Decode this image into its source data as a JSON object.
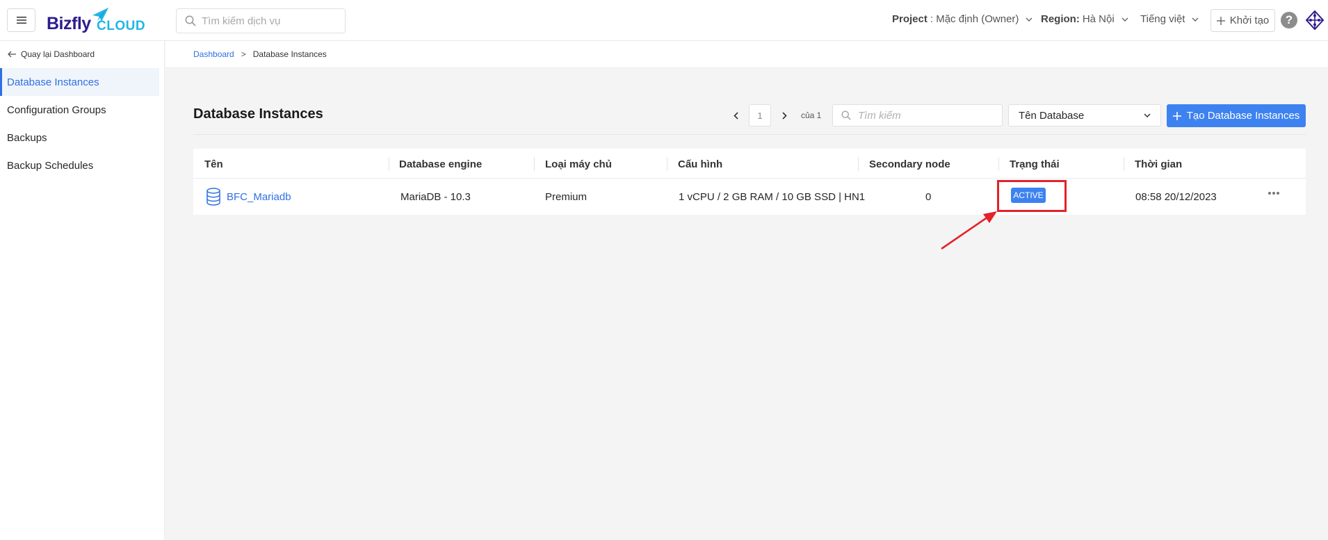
{
  "header": {
    "logo_word": "Bizfly",
    "logo_cloud": "CLOUD",
    "search_placeholder": "Tìm kiếm dịch vụ",
    "project_label": "Project",
    "project_value": ": Mặc định (Owner)",
    "region_label": "Region:",
    "region_value": " Hà Nội",
    "language": "Tiếng việt",
    "create_label": "Khởi tạo",
    "help_glyph": "?"
  },
  "sidebar": {
    "back_label": "Quay lại Dashboard",
    "items": [
      {
        "label": "Database Instances",
        "active": true
      },
      {
        "label": "Configuration Groups",
        "active": false
      },
      {
        "label": "Backups",
        "active": false
      },
      {
        "label": "Backup Schedules",
        "active": false
      }
    ]
  },
  "breadcrumb": {
    "root": "Dashboard",
    "separator": ">",
    "current": "Database Instances"
  },
  "toolbar": {
    "title": "Database Instances",
    "page_current": "1",
    "page_of": "của 1",
    "search_placeholder": "Tìm kiếm",
    "filter_selected": "Tên Database",
    "create_label": "Tạo Database Instances"
  },
  "table": {
    "columns": [
      "Tên",
      "Database engine",
      "Loại máy chủ",
      "Cấu hình",
      "Secondary node",
      "Trạng thái",
      "Thời gian"
    ],
    "rows": [
      {
        "name": "BFC_Mariadb",
        "engine": "MariaDB - 10.3",
        "server_type": "Premium",
        "config": "1 vCPU / 2 GB RAM / 10 GB SSD | HN1",
        "secondary_node": "0",
        "status": "ACTIVE",
        "time": "08:58 20/12/2023"
      }
    ]
  },
  "colors": {
    "brand_primary": "#2d1c8f",
    "brand_cloud": "#1fb6e6",
    "accent": "#3d82f0",
    "link": "#2f6fe4",
    "annotation": "#e5212a"
  }
}
